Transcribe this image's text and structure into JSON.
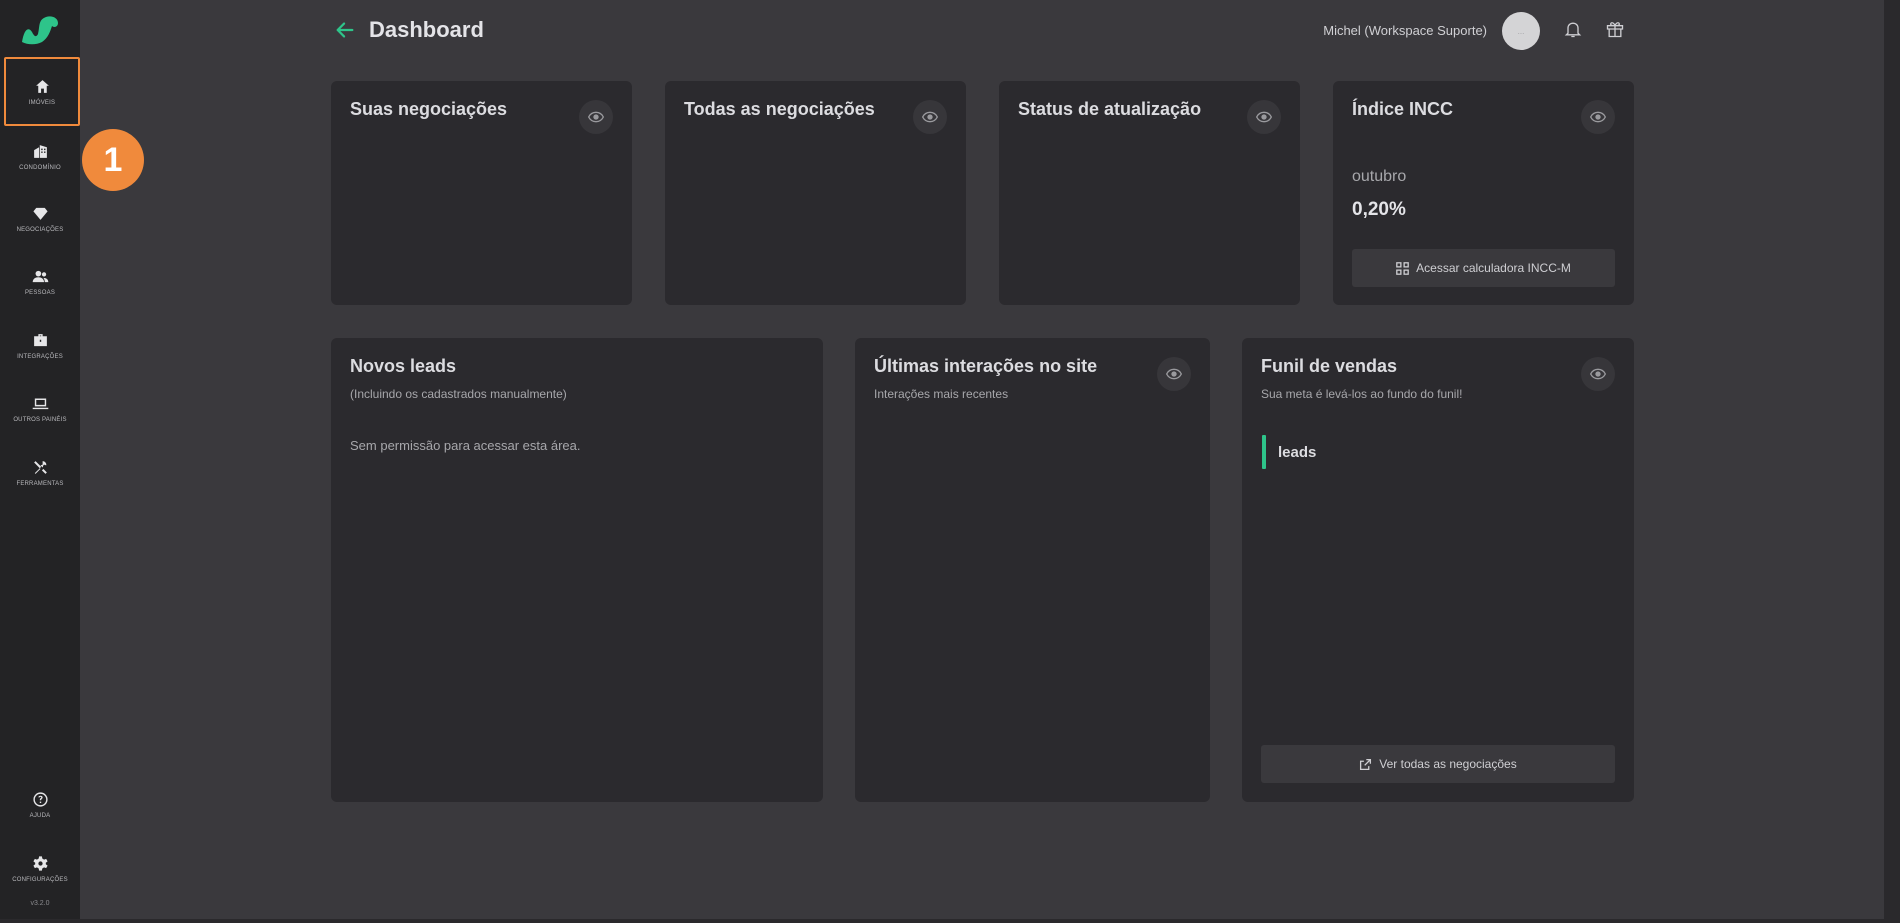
{
  "header": {
    "title": "Dashboard",
    "user_name": "Michel (Workspace Suporte)",
    "avatar_initials": "..."
  },
  "sidebar": {
    "items": [
      {
        "label": "IMÓVEIS",
        "icon": "home-icon"
      },
      {
        "label": "CONDOMÍNIO",
        "icon": "building-icon"
      },
      {
        "label": "NEGOCIAÇÕES",
        "icon": "diamond-icon"
      },
      {
        "label": "PESSOAS",
        "icon": "people-icon"
      },
      {
        "label": "INTEGRAÇÕES",
        "icon": "briefcase-icon"
      },
      {
        "label": "OUTROS PAINÉIS",
        "icon": "laptop-icon"
      },
      {
        "label": "FERRAMENTAS",
        "icon": "tools-icon"
      }
    ],
    "bottom": [
      {
        "label": "AJUDA",
        "icon": "help-icon"
      },
      {
        "label": "CONFIGURAÇÕES",
        "icon": "gear-icon"
      }
    ],
    "version": "v3.2.0"
  },
  "annotation": {
    "step": "1"
  },
  "cards": {
    "suas_negociacoes": {
      "title": "Suas negociações"
    },
    "todas_negociacoes": {
      "title": "Todas as negociações"
    },
    "status_atualizacao": {
      "title": "Status de atualização"
    },
    "incc": {
      "title": "Índice INCC",
      "month": "outubro",
      "value": "0,20%",
      "button": "Acessar calculadora INCC-M"
    },
    "novos_leads": {
      "title": "Novos leads",
      "subtitle": "(Incluindo os cadastrados manualmente)",
      "message": "Sem permissão para acessar esta área."
    },
    "ultimas_interacoes": {
      "title": "Últimas interações no site",
      "subtitle": "Interações mais recentes"
    },
    "funil": {
      "title": "Funil de vendas",
      "subtitle": "Sua meta é levá-los ao fundo do funil!",
      "stage": "leads",
      "button": "Ver todas as negociações"
    }
  },
  "colors": {
    "accent": "#2ec48a",
    "highlight": "#f08a3c",
    "background": "#3a393d",
    "card": "#2b2a2e",
    "sidebar": "#232325"
  }
}
